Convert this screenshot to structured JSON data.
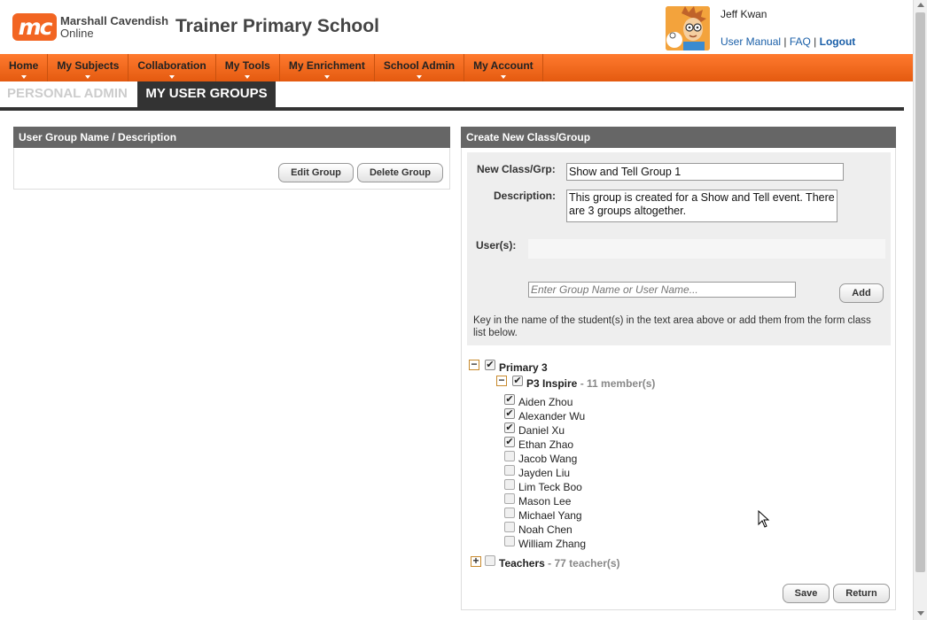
{
  "brand": {
    "mark": "mc",
    "line1": "Marshall Cavendish",
    "line2": "Online"
  },
  "school_name": "Trainer Primary School",
  "user": {
    "name": "Jeff Kwan",
    "manual": "User Manual",
    "sep1": " | ",
    "faq": "FAQ",
    "sep2": " | ",
    "logout": "Logout"
  },
  "nav": [
    "Home",
    "My Subjects",
    "Collaboration",
    "My Tools",
    "My Enrichment",
    "School Admin",
    "My Account"
  ],
  "subtabs": {
    "personal": "PERSONAL ADMIN",
    "groups": "MY USER GROUPS"
  },
  "left_panel": {
    "title": "User Group Name / Description",
    "edit": "Edit Group",
    "delete": "Delete Group"
  },
  "right_panel": {
    "title": "Create New Class/Group",
    "new_label": "New Class/Grp:",
    "new_value": "Show and Tell Group 1",
    "desc_label": "Description:",
    "desc_value": "This group is created for a Show and Tell event. There are 3 groups altogether.",
    "users_label": "User(s):",
    "search_placeholder": "Enter Group Name or User Name...",
    "add": "Add",
    "hint": "Key in the name of the student(s) in the text area above or add them from the form class list below.",
    "save": "Save",
    "return": "Return"
  },
  "tree": {
    "level": {
      "name": "Primary 3",
      "checked": true,
      "expanded": true
    },
    "cls": {
      "name": "P3 Inspire",
      "dash": " - ",
      "count": "11 member(s)",
      "checked": true,
      "expanded": true
    },
    "members": [
      {
        "name": "Aiden Zhou",
        "checked": true
      },
      {
        "name": "Alexander Wu",
        "checked": true
      },
      {
        "name": "Daniel Xu",
        "checked": true
      },
      {
        "name": "Ethan Zhao",
        "checked": true
      },
      {
        "name": "Jacob Wang",
        "checked": false
      },
      {
        "name": "Jayden Liu",
        "checked": false
      },
      {
        "name": "Lim Teck Boo",
        "checked": false
      },
      {
        "name": "Mason Lee",
        "checked": false
      },
      {
        "name": "Michael Yang",
        "checked": false
      },
      {
        "name": "Noah Chen",
        "checked": false
      },
      {
        "name": "William Zhang",
        "checked": false
      }
    ],
    "teachers": {
      "name": "Teachers",
      "dash": " - ",
      "count": "77 teacher(s)",
      "checked": false,
      "expanded": false
    }
  },
  "icons": {
    "expand": "plus-icon",
    "collapse": "minus-icon",
    "check": "checkmark-icon"
  },
  "colors": {
    "accent": "#f26522",
    "nav": "#ff7a2e",
    "panel_head": "#666666",
    "link": "#1a5fa8"
  }
}
